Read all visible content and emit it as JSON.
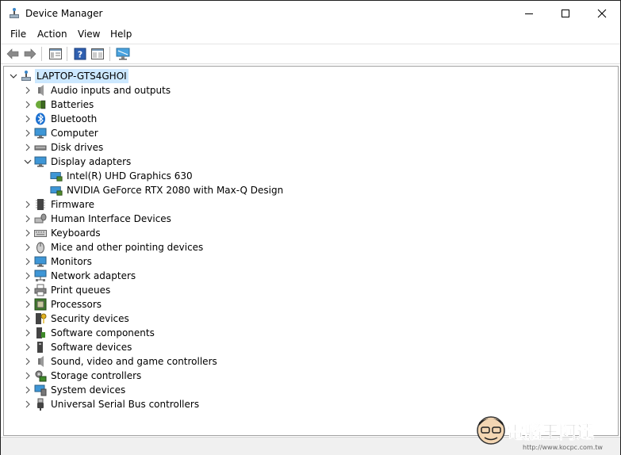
{
  "window": {
    "title": "Device Manager"
  },
  "menu": {
    "items": [
      "File",
      "Action",
      "View",
      "Help"
    ]
  },
  "tree": {
    "root": "LAPTOP-GTS4GHOI",
    "categories": [
      "Audio inputs and outputs",
      "Batteries",
      "Bluetooth",
      "Computer",
      "Disk drives",
      "Display adapters",
      "Firmware",
      "Human Interface Devices",
      "Keyboards",
      "Mice and other pointing devices",
      "Monitors",
      "Network adapters",
      "Print queues",
      "Processors",
      "Security devices",
      "Software components",
      "Software devices",
      "Sound, video and game controllers",
      "Storage controllers",
      "System devices",
      "Universal Serial Bus controllers"
    ],
    "display_adapters": [
      "Intel(R) UHD Graphics 630",
      "NVIDIA GeForce RTX 2080 with Max-Q Design"
    ]
  },
  "watermark": {
    "text": "電腦王阿達",
    "url": "http://www.kocpc.com.tw"
  },
  "colors": {
    "selection": "#cce8ff",
    "accent": "#1e73be"
  }
}
